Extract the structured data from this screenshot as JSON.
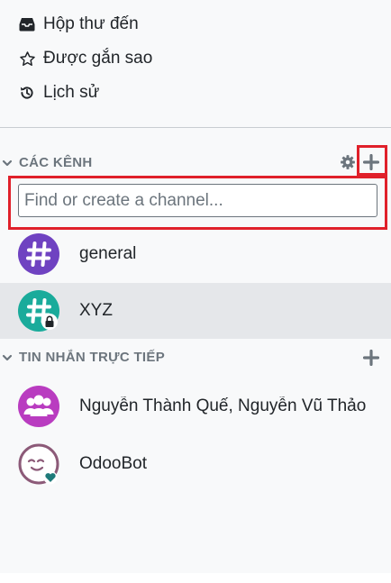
{
  "mailboxes": [
    {
      "label": "Hộp thư đến",
      "icon": "inbox-icon"
    },
    {
      "label": "Được gắn sao",
      "icon": "star-icon"
    },
    {
      "label": "Lịch sử",
      "icon": "history-icon"
    }
  ],
  "channels": {
    "title": "CÁC KÊNH",
    "search_placeholder": "Find or create a channel...",
    "items": [
      {
        "name": "general",
        "color": "#6f42c1",
        "locked": false
      },
      {
        "name": "XYZ",
        "color": "#1aab9b",
        "locked": true
      }
    ]
  },
  "direct_messages": {
    "title": "TIN NHẮN TRỰC TIẾP",
    "items": [
      {
        "name": "Nguyễn Thành Quế, Nguyễn Vũ Thảo",
        "icon": "group-avatar-icon"
      },
      {
        "name": "OdooBot",
        "icon": "odoobot-avatar-icon"
      }
    ]
  },
  "colors": {
    "accent_purple": "#6f42c1",
    "accent_teal": "#1aab9b",
    "dm_group_pink": "#b93cc0",
    "highlight_red": "#e0202a"
  }
}
